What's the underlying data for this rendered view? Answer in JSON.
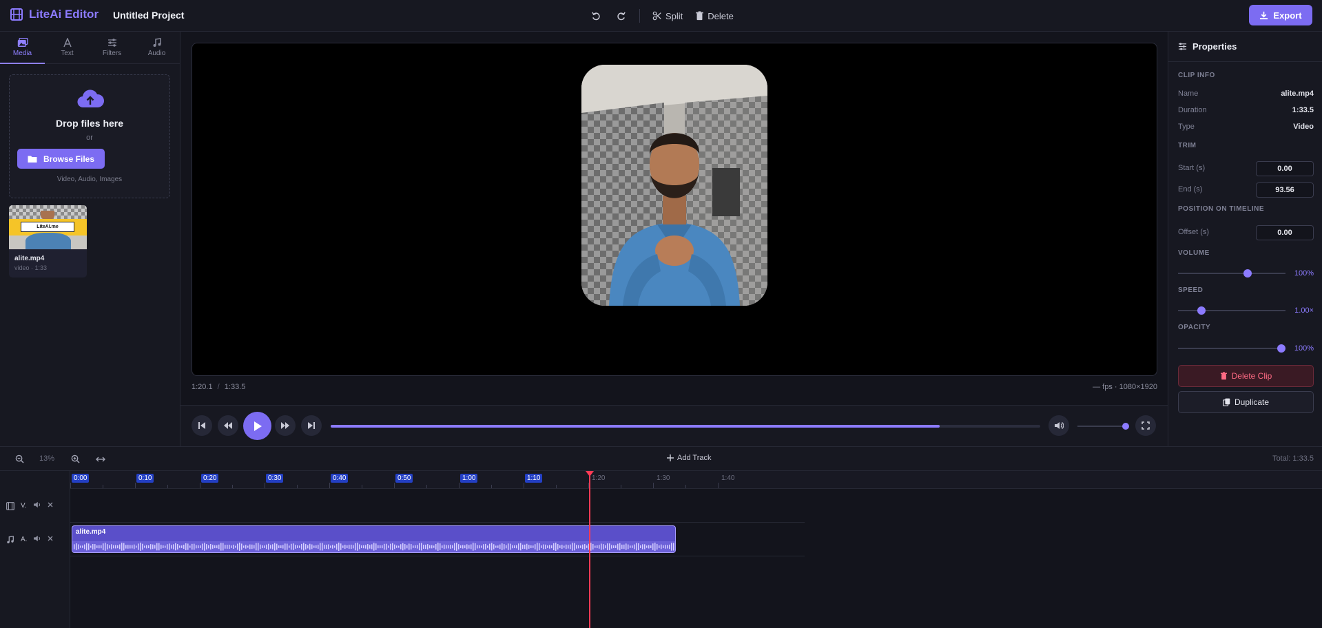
{
  "app": {
    "name": "LiteAi Editor",
    "project_title": "Untitled Project"
  },
  "toolbar": {
    "split_label": "Split",
    "delete_label": "Delete",
    "export_label": "Export"
  },
  "left_panel": {
    "tabs": [
      {
        "label": "Media",
        "icon": "image-icon",
        "active": true
      },
      {
        "label": "Text",
        "icon": "text-icon",
        "active": false
      },
      {
        "label": "Filters",
        "icon": "sliders-icon",
        "active": false
      },
      {
        "label": "Audio",
        "icon": "music-icon",
        "active": false
      }
    ],
    "dropzone": {
      "title": "Drop files here",
      "or": "or",
      "browse_label": "Browse Files",
      "types": "Video, Audio, Images"
    },
    "media": [
      {
        "name": "alite.mp4",
        "meta": "video · 1:33",
        "thumb_text": "LiteAI.me"
      }
    ]
  },
  "preview": {
    "current_time": "1:20.1",
    "separator": "/",
    "duration": "1:33.5",
    "fps_info": "— fps",
    "resolution": "· 1080×1920"
  },
  "transport": {
    "progress": 0.858,
    "volume": 0.88
  },
  "properties": {
    "title": "Properties",
    "clip_info_heading": "CLIP INFO",
    "name_label": "Name",
    "name_value": "alite.mp4",
    "duration_label": "Duration",
    "duration_value": "1:33.5",
    "type_label": "Type",
    "type_value": "Video",
    "trim_heading": "TRIM",
    "start_label": "Start (s)",
    "start_value": "0.00",
    "end_label": "End (s)",
    "end_value": "93.56",
    "position_heading": "POSITION ON TIMELINE",
    "offset_label": "Offset (s)",
    "offset_value": "0.00",
    "volume_heading": "VOLUME",
    "volume_value": "100%",
    "volume_level": 0.65,
    "speed_heading": "SPEED",
    "speed_value": "1.00×",
    "speed_level": 0.22,
    "opacity_heading": "OPACITY",
    "opacity_value": "100%",
    "opacity_level": 0.96,
    "delete_clip_label": "Delete Clip",
    "duplicate_label": "Duplicate"
  },
  "timeline": {
    "zoom": "13%",
    "add_track_label": "Add Track",
    "total": "Total: 1:33.5",
    "ticks": [
      "0:00",
      "0:10",
      "0:20",
      "0:30",
      "0:40",
      "0:50",
      "1:00",
      "1:10",
      "1:20",
      "1:30",
      "1:40"
    ],
    "tracks": [
      {
        "label": "V.",
        "icon": "film-icon"
      },
      {
        "label": "A.",
        "icon": "music-icon"
      }
    ],
    "clip_name": "alite.mp4"
  },
  "colors": {
    "accent": "#7c6cf2",
    "playhead": "#ff3b55",
    "danger": "#ff6b84"
  }
}
